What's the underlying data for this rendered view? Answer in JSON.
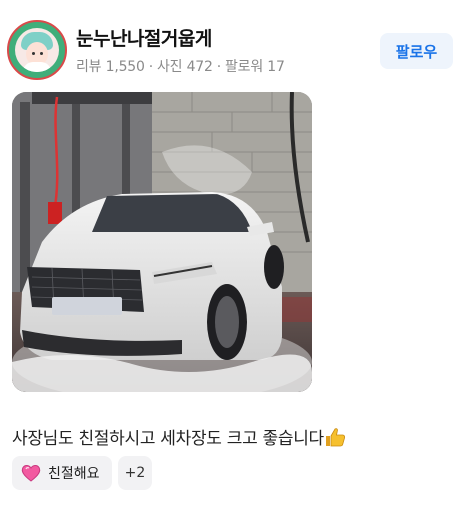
{
  "profile": {
    "username": "눈누난나절거웁게",
    "reviews_label": "리뷰 1,550",
    "photos_label": "사진 472",
    "followers_label": "팔로워 17",
    "separator": "·"
  },
  "actions": {
    "follow_label": "팔로우"
  },
  "review": {
    "text": "사장님도 친절하시고 세차장도 크고 좋습니다",
    "tags": [
      {
        "label": "친절해요",
        "icon": "heart-icon"
      }
    ],
    "more_tags_label": "+2"
  },
  "colors": {
    "accent": "#1a73e8",
    "follow_bg": "#eef4fc",
    "chip_bg": "#f2f2f4",
    "muted_text": "#8a8a8a"
  }
}
